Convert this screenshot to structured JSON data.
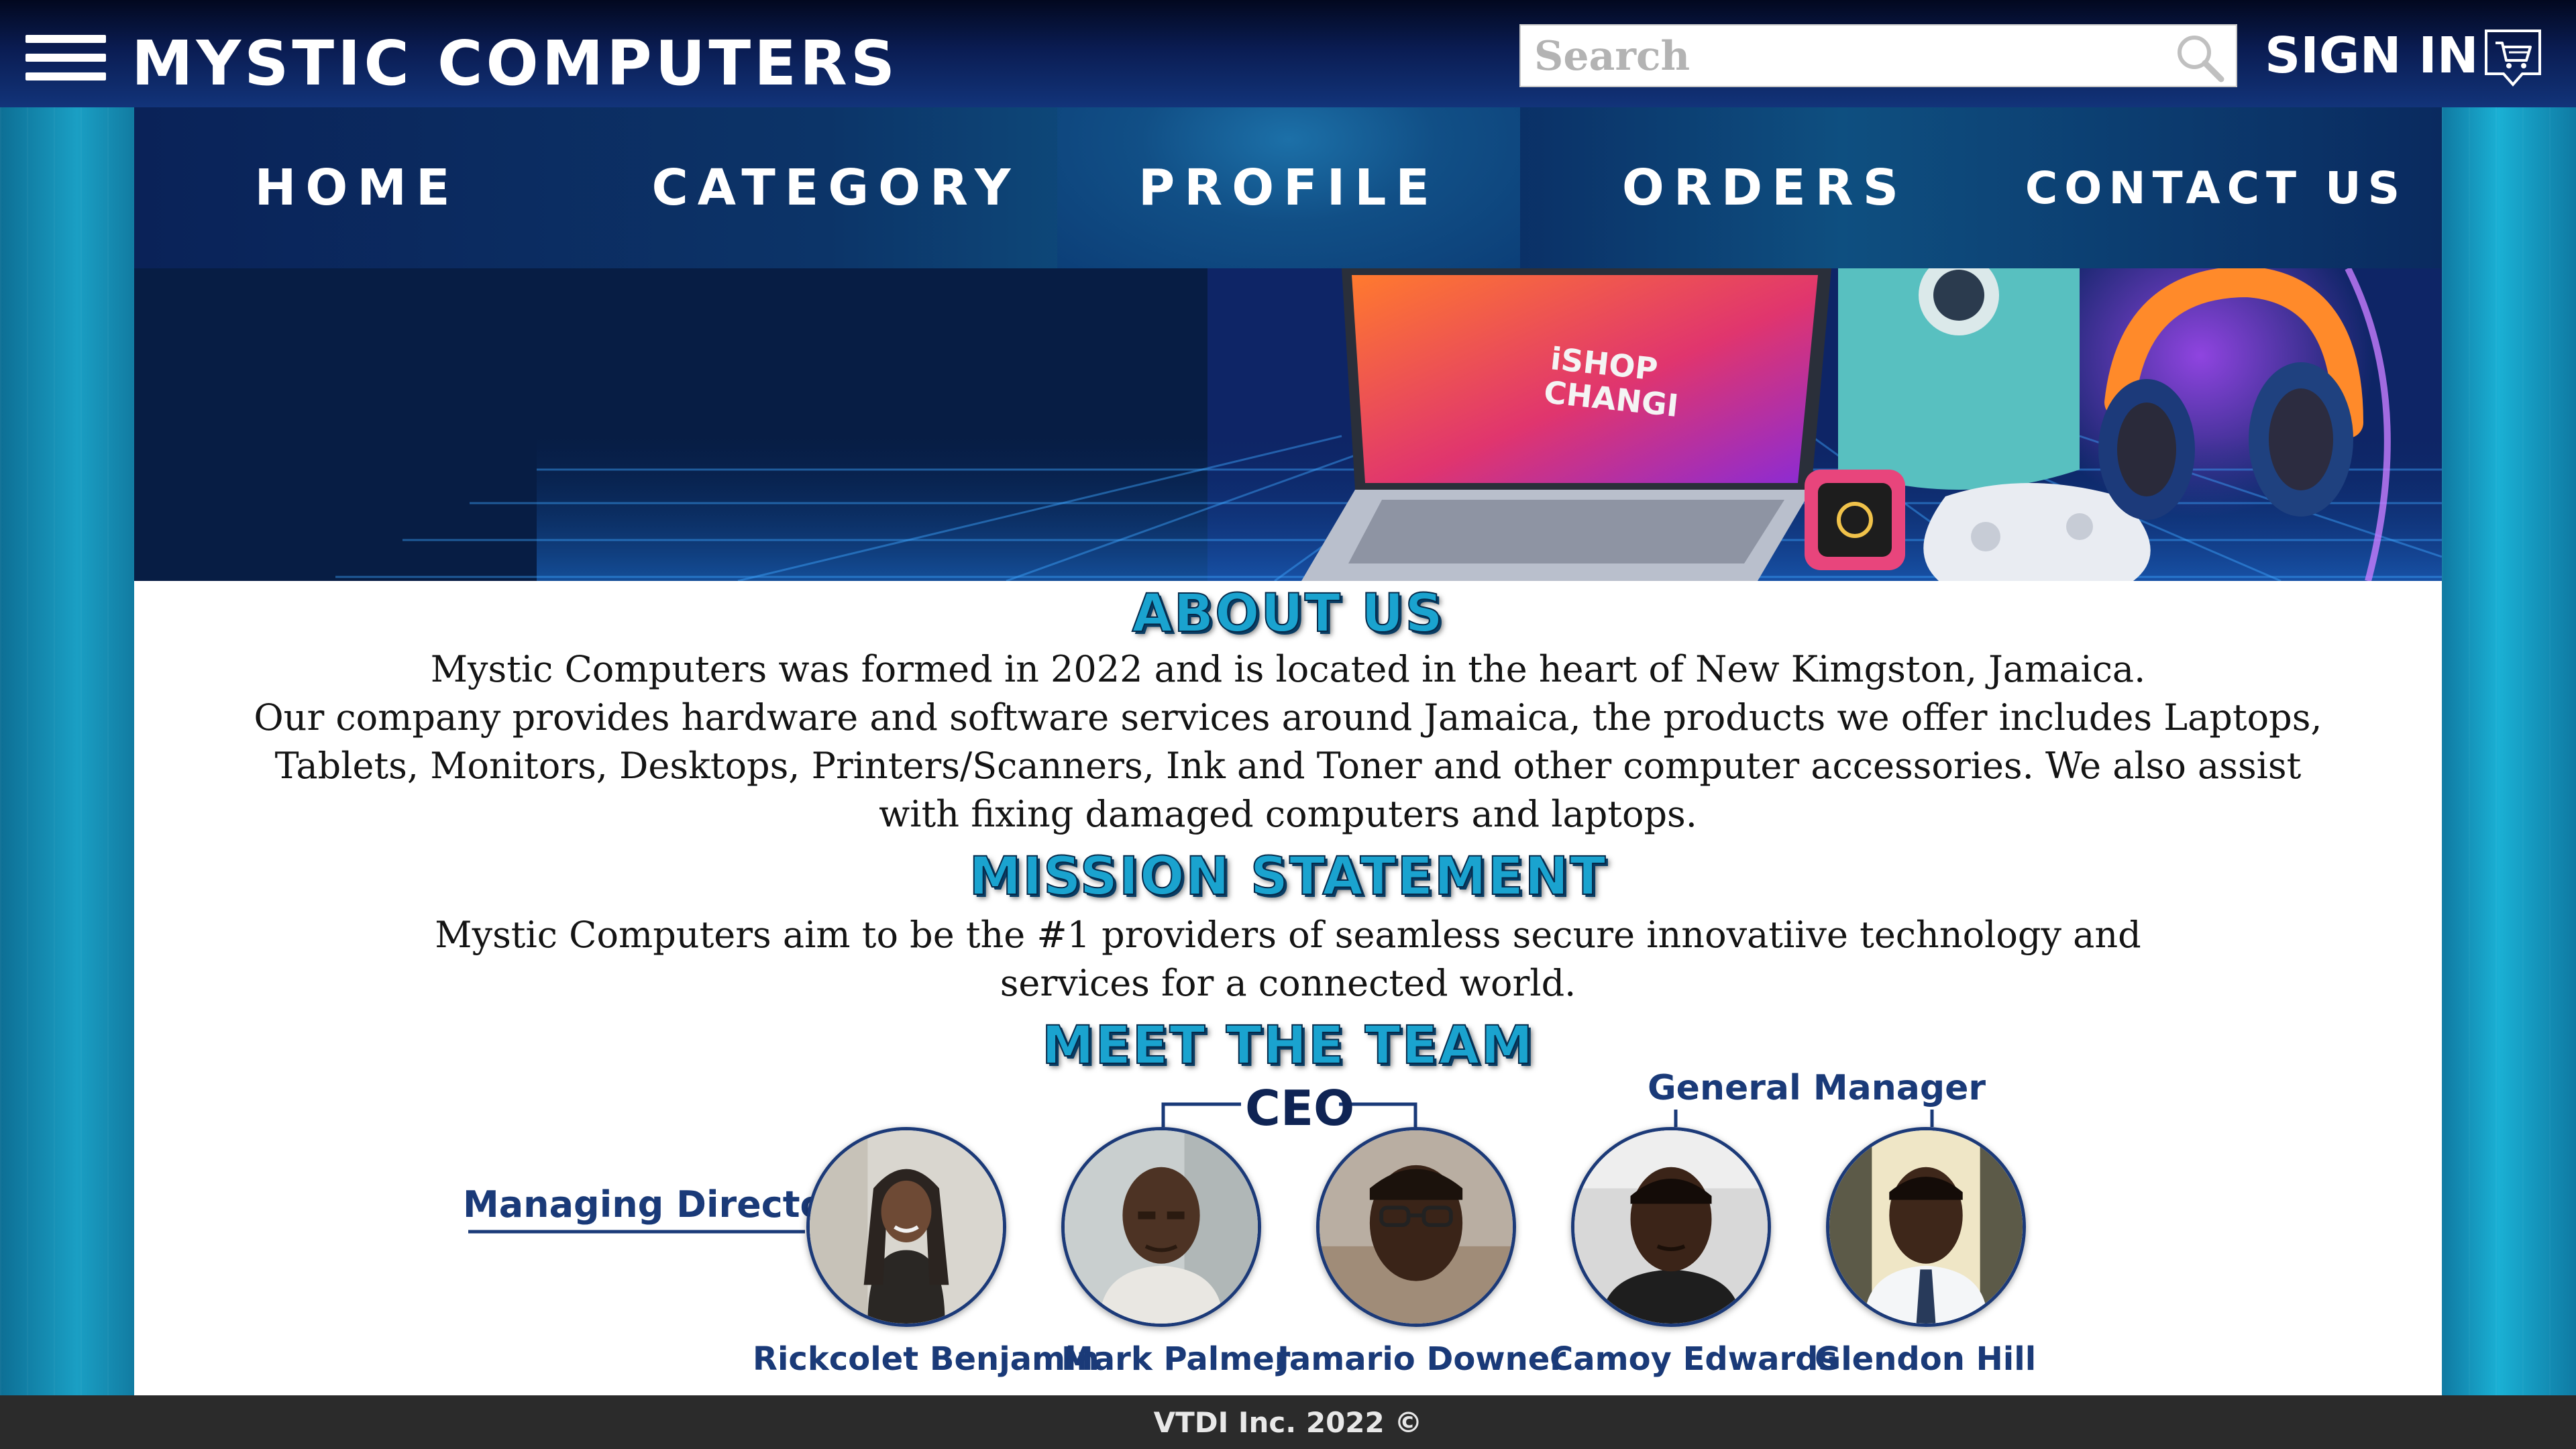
{
  "header": {
    "brand": "MYSTIC COMPUTERS",
    "search_placeholder": "Search",
    "sign_in": "SIGN IN",
    "icons": [
      "hamburger-menu-icon",
      "search-icon",
      "shopping-cart-icon"
    ]
  },
  "nav": {
    "items": [
      {
        "label": "HOME"
      },
      {
        "label": "CATEGORY"
      },
      {
        "label": "PROFILE",
        "active": true
      },
      {
        "label": "ORDERS"
      },
      {
        "label": "CONTACT US"
      }
    ]
  },
  "banner": {
    "laptop_screen_text_line1": "iSHOP",
    "laptop_screen_text_line2": "CHANGI"
  },
  "about": {
    "title": "ABOUT US",
    "line1": "Mystic Computers was formed in 2022 and is located in the heart of New Kimgston, Jamaica.",
    "body": "Our company provides hardware and software services around Jamaica, the products we offer includes Laptops, Tablets, Monitors, Desktops, Printers/Scanners, Ink and Toner and other computer accessories. We also assist with fixing damaged computers and laptops."
  },
  "mission": {
    "title": "MISSION STATEMENT",
    "body": "Mystic Computers aim to be the #1 providers of seamless secure innovatiive technology and services for a connected world."
  },
  "team": {
    "title": "MEET THE TEAM",
    "roles": {
      "managing_director": "Managing Director",
      "ceo": "CEO",
      "general_manager": "General Manager"
    },
    "members": [
      {
        "name": "Rickcolet Benjamin"
      },
      {
        "name": "Mark Palmer"
      },
      {
        "name": "Jamario Downer"
      },
      {
        "name": "Camoy Edwards"
      },
      {
        "name": "Glendon Hill"
      }
    ]
  },
  "footer": {
    "text": "VTDI Inc. 2022 ©"
  },
  "colors": {
    "header_dark": "#0a1c52",
    "heading_cyan": "#1aa3cf",
    "role_navy": "#1a3a78",
    "footer": "#2b2b2b"
  }
}
